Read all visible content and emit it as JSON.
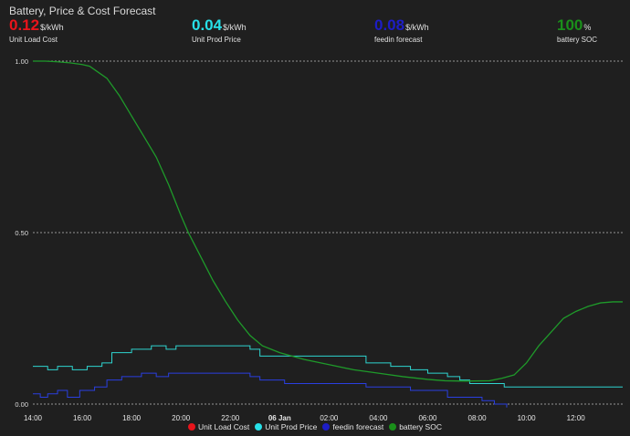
{
  "card": {
    "title": "Battery, Price & Cost Forecast"
  },
  "stats": [
    {
      "value": "0.12",
      "unit": "$/kWh",
      "name": "Unit Load Cost",
      "color": "#e8141b"
    },
    {
      "value": "0.04",
      "unit": "$/kWh",
      "name": "Unit Prod Price",
      "color": "#27e0e8"
    },
    {
      "value": "0.08",
      "unit": "$/kWh",
      "name": "feedin forecast",
      "color": "#1d1dc6"
    },
    {
      "value": "100",
      "unit": "%",
      "name": "battery SOC",
      "color": "#1a8f1a"
    }
  ],
  "chart_data": {
    "type": "line",
    "x_ticks": [
      "14:00",
      "16:00",
      "18:00",
      "20:00",
      "22:00",
      "06 Jan",
      "02:00",
      "04:00",
      "06:00",
      "08:00",
      "10:00",
      "12:00"
    ],
    "y_ticks": [
      "0.00",
      "0.50",
      "1.00"
    ],
    "ylim": [
      0,
      1
    ],
    "xlim_hours": [
      14,
      37.9
    ],
    "grid": true,
    "legend_position": "bottom",
    "series": [
      {
        "name": "Unit Load Cost",
        "color": "#e8141b",
        "step": true,
        "points": []
      },
      {
        "name": "Unit Prod Price",
        "color": "#2fd4cf",
        "step": true,
        "points": [
          [
            14,
            0.11
          ],
          [
            14.6,
            0.1
          ],
          [
            15,
            0.11
          ],
          [
            15.6,
            0.1
          ],
          [
            16.2,
            0.11
          ],
          [
            16.8,
            0.12
          ],
          [
            17.2,
            0.15
          ],
          [
            18,
            0.16
          ],
          [
            18.8,
            0.17
          ],
          [
            19.4,
            0.16
          ],
          [
            19.8,
            0.17
          ],
          [
            21.5,
            0.17
          ],
          [
            22.3,
            0.17
          ],
          [
            22.8,
            0.16
          ],
          [
            23.2,
            0.14
          ],
          [
            27,
            0.14
          ],
          [
            27.5,
            0.12
          ],
          [
            28.5,
            0.11
          ],
          [
            29.3,
            0.1
          ],
          [
            30,
            0.09
          ],
          [
            30.8,
            0.08
          ],
          [
            31.3,
            0.07
          ],
          [
            31.7,
            0.06
          ],
          [
            33.1,
            0.05
          ],
          [
            33.7,
            0.05
          ],
          [
            37.9,
            0.05
          ]
        ]
      },
      {
        "name": "feedin forecast",
        "color": "#2a3fe0",
        "step": true,
        "points": [
          [
            14,
            0.03
          ],
          [
            14.3,
            0.02
          ],
          [
            14.6,
            0.03
          ],
          [
            15,
            0.04
          ],
          [
            15.4,
            0.02
          ],
          [
            15.9,
            0.04
          ],
          [
            16.5,
            0.05
          ],
          [
            17,
            0.07
          ],
          [
            17.6,
            0.08
          ],
          [
            18.4,
            0.09
          ],
          [
            19,
            0.08
          ],
          [
            19.5,
            0.09
          ],
          [
            21.5,
            0.09
          ],
          [
            22.3,
            0.09
          ],
          [
            22.8,
            0.08
          ],
          [
            23.2,
            0.07
          ],
          [
            24.2,
            0.06
          ],
          [
            25.5,
            0.06
          ],
          [
            27,
            0.06
          ],
          [
            27.5,
            0.05
          ],
          [
            28.5,
            0.05
          ],
          [
            29.3,
            0.04
          ],
          [
            30,
            0.04
          ],
          [
            30.8,
            0.02
          ],
          [
            31.3,
            0.02
          ],
          [
            32.2,
            0.01
          ],
          [
            32.7,
            0.0
          ],
          [
            33.2,
            -0.01
          ]
        ]
      },
      {
        "name": "battery SOC",
        "color": "#1f9a2a",
        "step": false,
        "points": [
          [
            14,
            1.0
          ],
          [
            14.5,
            1.0
          ],
          [
            15,
            0.998
          ],
          [
            15.5,
            0.995
          ],
          [
            16,
            0.99
          ],
          [
            16.3,
            0.985
          ],
          [
            16.6,
            0.97
          ],
          [
            17,
            0.95
          ],
          [
            17.5,
            0.9
          ],
          [
            18,
            0.84
          ],
          [
            18.5,
            0.78
          ],
          [
            19,
            0.72
          ],
          [
            19.5,
            0.64
          ],
          [
            20,
            0.55
          ],
          [
            20.3,
            0.5
          ],
          [
            20.8,
            0.43
          ],
          [
            21.3,
            0.36
          ],
          [
            21.8,
            0.3
          ],
          [
            22.3,
            0.245
          ],
          [
            22.8,
            0.2
          ],
          [
            23.3,
            0.17
          ],
          [
            24,
            0.15
          ],
          [
            25,
            0.13
          ],
          [
            26,
            0.115
          ],
          [
            27,
            0.1
          ],
          [
            28,
            0.09
          ],
          [
            29,
            0.08
          ],
          [
            30,
            0.072
          ],
          [
            30.7,
            0.068
          ],
          [
            31.5,
            0.067
          ],
          [
            32.5,
            0.068
          ],
          [
            33,
            0.075
          ],
          [
            33.5,
            0.085
          ],
          [
            34,
            0.12
          ],
          [
            34.5,
            0.17
          ],
          [
            35,
            0.21
          ],
          [
            35.5,
            0.25
          ],
          [
            36,
            0.27
          ],
          [
            36.5,
            0.285
          ],
          [
            37,
            0.295
          ],
          [
            37.5,
            0.298
          ],
          [
            37.9,
            0.298
          ]
        ]
      }
    ]
  }
}
